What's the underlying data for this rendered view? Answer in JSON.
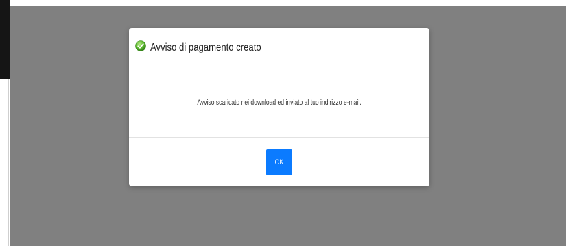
{
  "dialog": {
    "title": "Avviso di pagamento creato",
    "icon": "check-circle-icon",
    "message": "Avviso scaricato nei download ed inviato al tuo indirizzo e-mail.",
    "ok_label": "OK"
  },
  "colors": {
    "overlay": "#808080",
    "primary_button": "#0b7bff",
    "success_icon": "#5cb82e"
  }
}
